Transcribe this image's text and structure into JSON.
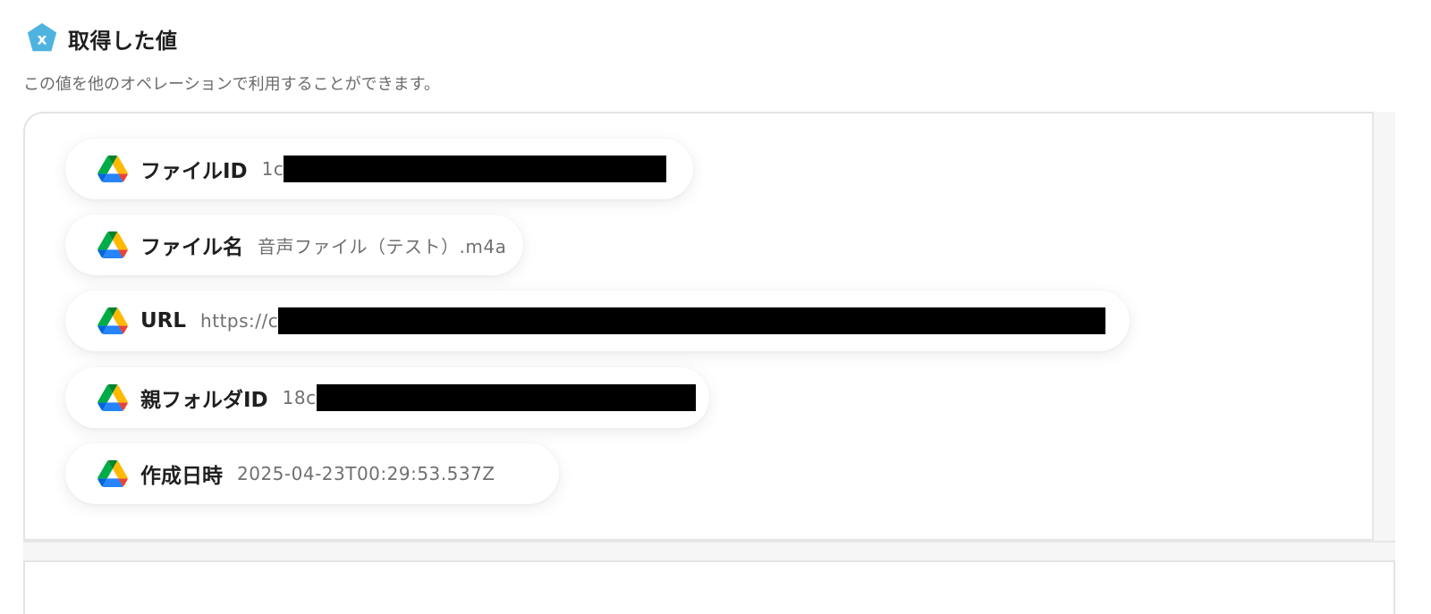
{
  "header": {
    "title": "取得した値",
    "icon": "variable-x-icon",
    "icon_color": "#4fb3e0"
  },
  "subtitle": "この値を他のオペレーションで利用することができます。",
  "items": [
    {
      "label": "ファイルID",
      "value": "1c",
      "icon": "google-drive-icon",
      "redacted": true
    },
    {
      "label": "ファイル名",
      "value": "音声ファイル（テスト）.m4a",
      "icon": "google-drive-icon",
      "redacted": false
    },
    {
      "label": "URL",
      "value": "https://c",
      "icon": "google-drive-icon",
      "redacted": true
    },
    {
      "label": "親フォルダID",
      "value": "18c",
      "icon": "google-drive-icon",
      "redacted": true
    },
    {
      "label": "作成日時",
      "value": "2025-04-23T00:29:53.537Z",
      "icon": "google-drive-icon",
      "redacted": false
    }
  ]
}
